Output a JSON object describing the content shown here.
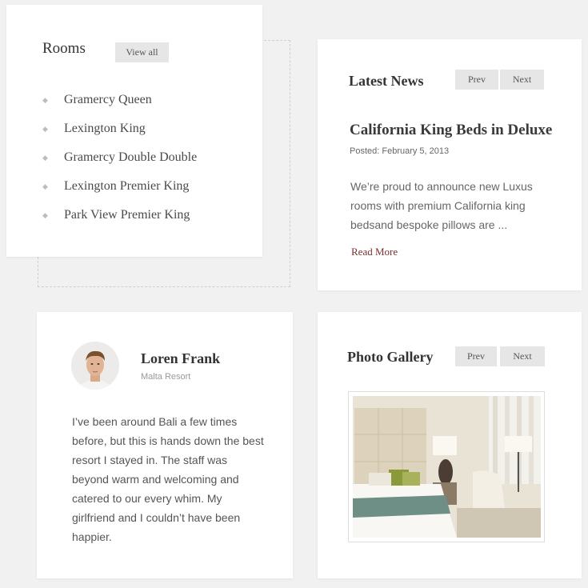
{
  "rooms": {
    "title": "Rooms",
    "view_all_label": "View all",
    "items": [
      {
        "label": "Gramercy Queen"
      },
      {
        "label": "Lexington King"
      },
      {
        "label": "Gramercy Double Double"
      },
      {
        "label": "Lexington Premier King"
      },
      {
        "label": "Park View Premier King"
      }
    ],
    "bullet_icon": "diamond-bullet-icon"
  },
  "news": {
    "title": "Latest News",
    "prev_label": "Prev",
    "next_label": "Next",
    "headline": "California King Beds in Deluxe",
    "posted": "Posted: February 5, 2013",
    "excerpt": "We’re proud to announce new Luxus rooms with premium California king bedsand  bespoke pillows are ...",
    "read_more": "Read More",
    "link_color": "#7a2e2e"
  },
  "testimonial": {
    "name": "Loren Frank",
    "organization": "Malta Resort",
    "quote": "I’ve been around Bali a few times before, but this is hands down the best resort I stayed in. The staff was beyond warm and welcoming and catered to our every whim. My girlfriend and I couldn’t have been happier."
  },
  "gallery": {
    "title": "Photo Gallery",
    "prev_label": "Prev",
    "next_label": "Next",
    "photo_subject": "hotel-bedroom-photo"
  }
}
